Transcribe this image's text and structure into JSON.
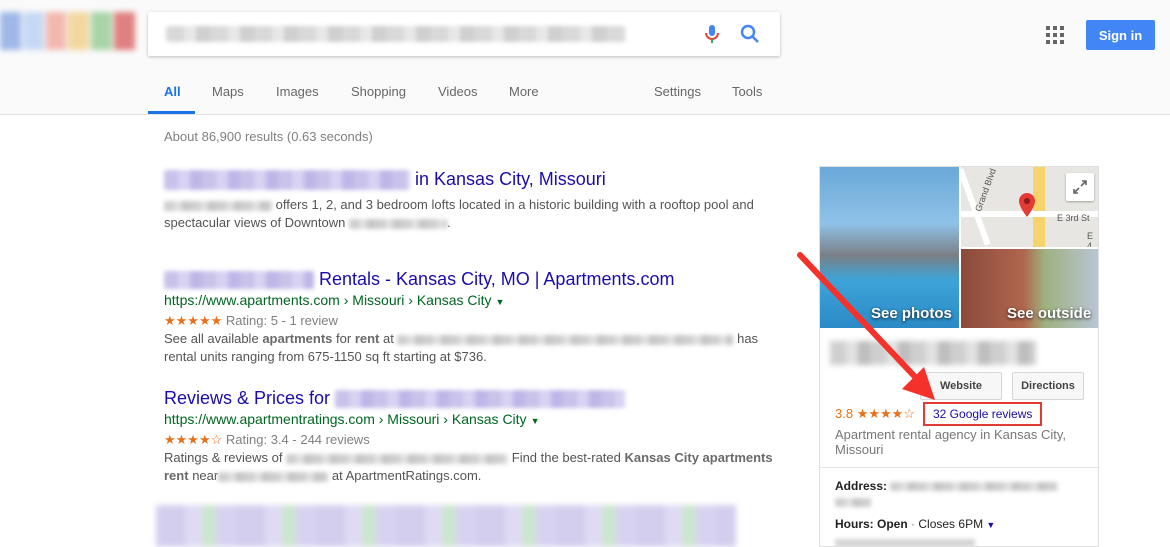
{
  "header": {
    "signin_label": "Sign in",
    "logo_colors": [
      "#9fb8e8",
      "#c7d8f4",
      "#f2b8b0",
      "#f3d7a0",
      "#a8d4a8",
      "#e08080"
    ]
  },
  "tabs": [
    {
      "label": "All",
      "active": true
    },
    {
      "label": "Maps"
    },
    {
      "label": "Images"
    },
    {
      "label": "Shopping"
    },
    {
      "label": "Videos"
    },
    {
      "label": "More"
    },
    {
      "label": "Settings"
    },
    {
      "label": "Tools"
    }
  ],
  "stats": "About 86,900 results (0.63 seconds)",
  "results": [
    {
      "title_suffix": "in Kansas City, Missouri",
      "snippet_a": "offers 1, 2, and 3 bedroom lofts located in a historic building with a rooftop pool and",
      "snippet_b": "spectacular views of Downtown",
      "snippet_end": "."
    },
    {
      "title_suffix": "Rentals - Kansas City, MO | Apartments.com",
      "url": "https://www.apartments.com › Missouri › Kansas City",
      "stars": "★★★★★",
      "rating": "Rating: 5 - 1 review",
      "snippet_see": "See all available",
      "snippet_apartments": "apartments",
      "snippet_for": "for",
      "snippet_rent": "rent",
      "snippet_at": "at",
      "snippet_has": "has",
      "snippet_line2": "rental units ranging from 675-1150 sq ft starting at $736."
    },
    {
      "title_prefix": "Reviews & Prices for",
      "url": "https://www.apartmentratings.com › Missouri › Kansas City",
      "stars": "★★★★☆",
      "rating": "Rating: 3.4 - 244 reviews",
      "snippet_a": "Ratings & reviews of",
      "snippet_b": "Find the best-rated",
      "snippet_bold": "Kansas City apartments",
      "snippet_for": "for",
      "snippet_rent": "rent",
      "snippet_near": "near",
      "snippet_end": "at ApartmentRatings.com."
    }
  ],
  "knowledge_panel": {
    "see_photos": "See photos",
    "see_outside": "See outside",
    "map_label_1": "Grand Blvd",
    "map_label_2": "E 3rd St",
    "map_label_3": "E 4",
    "website_label": "Website",
    "directions_label": "Directions",
    "rating_value": "3.8",
    "rating_stars": "★★★★☆",
    "reviews_link": "32 Google reviews",
    "category": "Apartment rental agency in Kansas City, Missouri",
    "address_label": "Address:",
    "hours_label": "Hours:",
    "hours_status": "Open",
    "hours_close": "Closes 6PM",
    "accent_color": "#e53935"
  }
}
